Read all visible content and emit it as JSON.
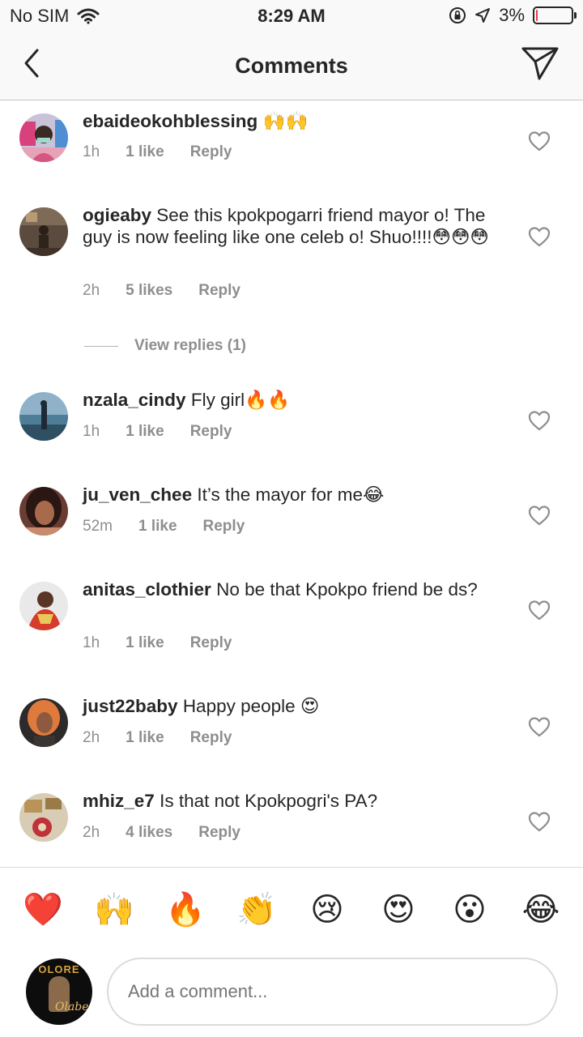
{
  "status_bar": {
    "carrier": "No SIM",
    "time": "8:29 AM",
    "battery": "3%",
    "battery_level": 0.03
  },
  "header": {
    "title": "Comments"
  },
  "comments": [
    {
      "username": "ebaideokohblessing",
      "text": "🙌🙌",
      "time": "1h",
      "likes": "1 like",
      "reply": "Reply"
    },
    {
      "username": "ogieaby",
      "text": "See this kpokpogarri friend mayor o! The guy is now feeling like one celeb o! Shuo!!!!😳😳😳",
      "time": "2h",
      "likes": "5 likes",
      "reply": "Reply",
      "view_replies": "View replies (1)"
    },
    {
      "username": "nzala_cindy",
      "text": "Fly girl🔥🔥",
      "time": "1h",
      "likes": "1 like",
      "reply": "Reply"
    },
    {
      "username": "ju_ven_chee",
      "text": "It’s the  mayor for me😂",
      "time": "52m",
      "likes": "1 like",
      "reply": "Reply"
    },
    {
      "username": "anitas_clothier",
      "text": "No be that Kpokpo friend be ds?",
      "time": "1h",
      "likes": "1 like",
      "reply": "Reply"
    },
    {
      "username": "just22baby",
      "text": "Happy people 😍",
      "time": "2h",
      "likes": "1 like",
      "reply": "Reply"
    },
    {
      "username": "mhiz_e7",
      "text": "Is that not Kpokpogri's PA?",
      "time": "2h",
      "likes": "4 likes",
      "reply": "Reply"
    }
  ],
  "emoji_bar": [
    "❤️",
    "🙌",
    "🔥",
    "👏",
    "😢",
    "😍",
    "😮",
    "😂"
  ],
  "composer": {
    "placeholder": "Add a comment...",
    "avatar_text": "OLORE",
    "avatar_signature": "Olabese"
  }
}
